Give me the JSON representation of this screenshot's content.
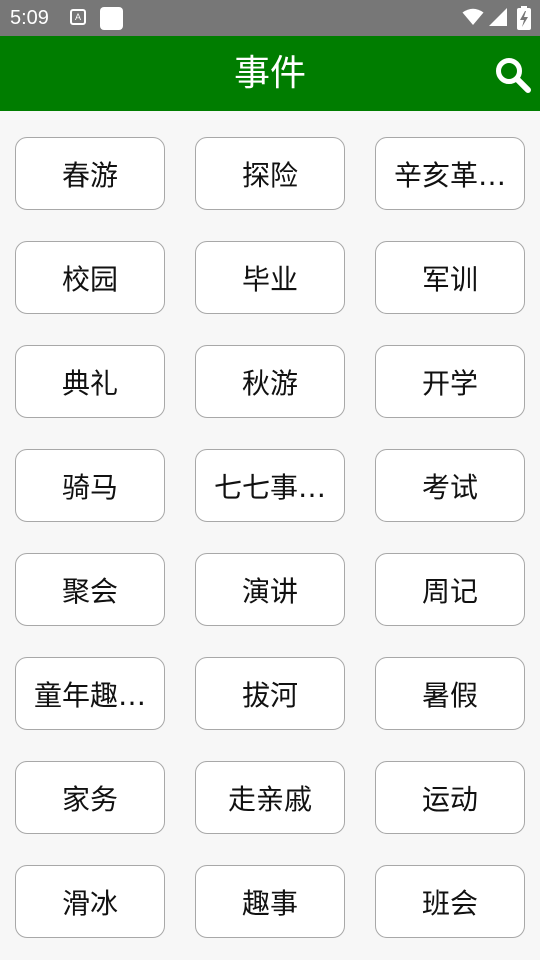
{
  "status_bar": {
    "time": "5:09",
    "icon_a_glyph": "A",
    "icons": [
      "font-notification-icon",
      "app-notification-icon",
      "wifi-icon",
      "signal-icon",
      "battery-charging-icon"
    ]
  },
  "app_bar": {
    "title": "事件",
    "search_icon": "search-icon",
    "color": "#007d00"
  },
  "events": [
    "春游",
    "探险",
    "辛亥革…",
    "校园",
    "毕业",
    "军训",
    "典礼",
    "秋游",
    "开学",
    "骑马",
    "七七事…",
    "考试",
    "聚会",
    "演讲",
    "周记",
    "童年趣…",
    "拔河",
    "暑假",
    "家务",
    "走亲戚",
    "运动",
    "滑冰",
    "趣事",
    "班会"
  ]
}
